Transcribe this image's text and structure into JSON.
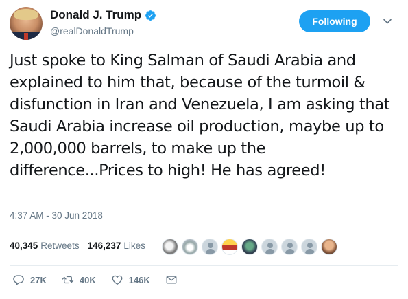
{
  "user": {
    "display_name": "Donald J. Trump",
    "handle": "@realDonaldTrump",
    "verified": true,
    "follow_button_label": "Following"
  },
  "tweet": {
    "text": "Just spoke to King Salman of Saudi Arabia and explained to him that, because of the turmoil & disfunction in Iran and Venezuela, I am asking that Saudi Arabia increase oil production, maybe up to 2,000,000 barrels, to make up the difference...Prices to high! He has agreed!",
    "timestamp": "4:37 AM - 30 Jun 2018"
  },
  "stats": {
    "retweets_count": "40,345",
    "retweets_label": "Retweets",
    "likes_count": "146,237",
    "likes_label": "Likes"
  },
  "actions": {
    "replies": "27K",
    "retweets": "40K",
    "likes": "146K"
  },
  "colors": {
    "accent": "#1da1f2",
    "secondary_text": "#657786",
    "primary_text": "#14171a"
  },
  "icons": [
    "verified-badge-icon",
    "chevron-down-icon",
    "reply-icon",
    "retweet-icon",
    "heart-icon",
    "message-icon"
  ]
}
